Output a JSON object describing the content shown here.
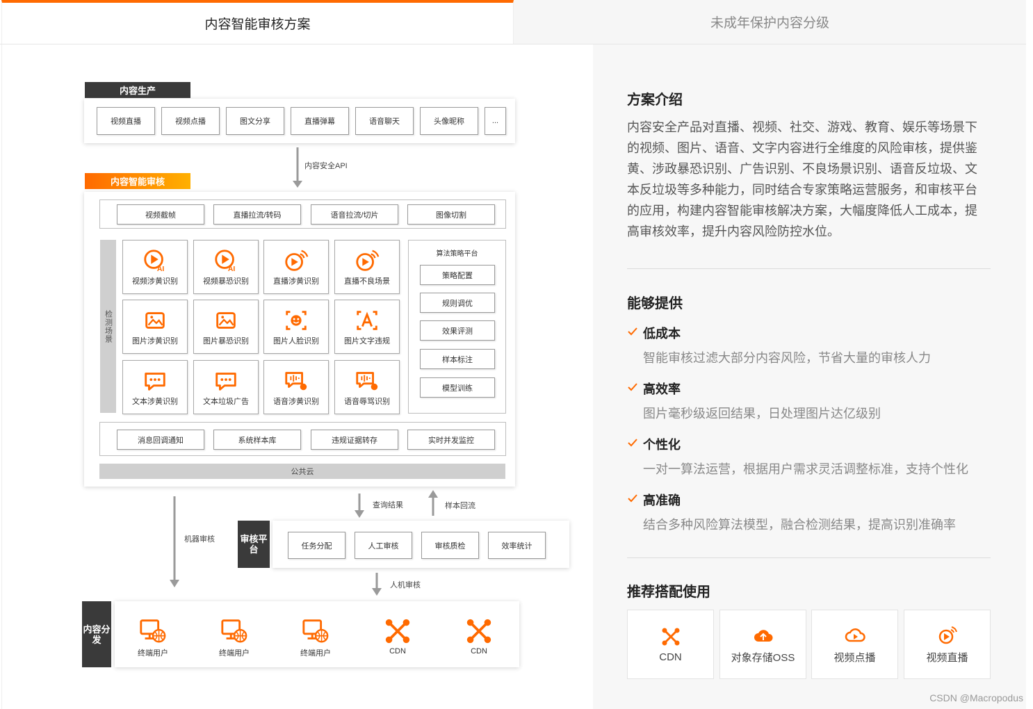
{
  "tabs": {
    "active": "内容智能审核方案",
    "inactive": "未成年保护内容分级"
  },
  "diagram": {
    "production": {
      "title": "内容生产",
      "items": [
        "视频直播",
        "视频点播",
        "图文分享",
        "直播弹幕",
        "语音聊天",
        "头像昵称",
        "..."
      ]
    },
    "api_label": "内容安全API",
    "audit": {
      "title": "内容智能审核",
      "preprocess": [
        "视频截帧",
        "直播拉流/转码",
        "语音拉流/切片",
        "图像切割"
      ],
      "scene_label": "检测场景",
      "scenes": [
        {
          "label": "视频涉黄识别",
          "icon": "video-ai-icon"
        },
        {
          "label": "视频暴恐识别",
          "icon": "video-ai-icon"
        },
        {
          "label": "直播涉黄识别",
          "icon": "live-icon"
        },
        {
          "label": "直播不良场景",
          "icon": "live-icon"
        },
        {
          "label": "图片涉黄识别",
          "icon": "image-icon"
        },
        {
          "label": "图片暴恐识别",
          "icon": "image-icon"
        },
        {
          "label": "图片人脸识别",
          "icon": "face-icon"
        },
        {
          "label": "图片文字违规",
          "icon": "text-a-icon"
        },
        {
          "label": "文本涉黄识别",
          "icon": "chat-icon"
        },
        {
          "label": "文本垃圾广告",
          "icon": "chat-icon"
        },
        {
          "label": "语音涉黄识别",
          "icon": "voice-icon"
        },
        {
          "label": "语音辱骂识别",
          "icon": "voice-icon"
        }
      ],
      "algo": {
        "title": "算法策略平台",
        "items": [
          "策略配置",
          "规则调优",
          "效果评测",
          "样本标注",
          "模型训练"
        ]
      },
      "services": [
        "消息回调通知",
        "系统样本库",
        "违规证据转存",
        "实时并发监控"
      ],
      "cloud": "公共云"
    },
    "query_result": "查询结果",
    "sample_back": "样本回流",
    "machine_review": "机器审核",
    "review_platform": {
      "title": "审核平台",
      "items": [
        "任务分配",
        "人工审核",
        "审核质检",
        "效率统计"
      ]
    },
    "human_machine": "人机审核",
    "distribution": {
      "title": "内容分发",
      "items": [
        {
          "label": "终端用户",
          "icon": "terminal-user-icon"
        },
        {
          "label": "终端用户",
          "icon": "terminal-user-icon"
        },
        {
          "label": "终端用户",
          "icon": "terminal-user-icon"
        },
        {
          "label": "CDN",
          "icon": "cdn-icon"
        },
        {
          "label": "CDN",
          "icon": "cdn-icon"
        }
      ]
    }
  },
  "right": {
    "intro_title": "方案介绍",
    "intro_text": "内容安全产品对直播、视频、社交、游戏、教育、娱乐等场景下的视频、图片、语音、文字内容进行全维度的风险审核，提供鉴黄、涉政暴恐识别、广告识别、不良场景识别、语音反垃圾、文本反垃圾等多种能力，同时结合专家策略运营服务，和审核平台的应用，构建内容智能审核解决方案，大幅度降低人工成本，提高审核效率，提升内容风险防控水位。",
    "provide_title": "能够提供",
    "features": [
      {
        "title": "低成本",
        "desc": "智能审核过滤大部分内容风险，节省大量的审核人力"
      },
      {
        "title": "高效率",
        "desc": "图片毫秒级返回结果，日处理图片达亿级别"
      },
      {
        "title": "个性化",
        "desc": "一对一算法运营，根据用户需求灵活调整标准，支持个性化"
      },
      {
        "title": "高准确",
        "desc": "结合多种风险算法模型，融合检测结果，提高识别准确率"
      }
    ],
    "recommend_title": "推荐搭配使用",
    "recommend": [
      {
        "label": "CDN",
        "icon": "cdn-icon"
      },
      {
        "label": "对象存储OSS",
        "icon": "cloud-upload-icon"
      },
      {
        "label": "视频点播",
        "icon": "video-cloud-icon"
      },
      {
        "label": "视频直播",
        "icon": "live-icon"
      }
    ]
  },
  "watermark": "CSDN @Macropodus",
  "colors": {
    "accent": "#ff6a00",
    "dark": "#3a3a3a",
    "grey": "#cfcfcf"
  }
}
